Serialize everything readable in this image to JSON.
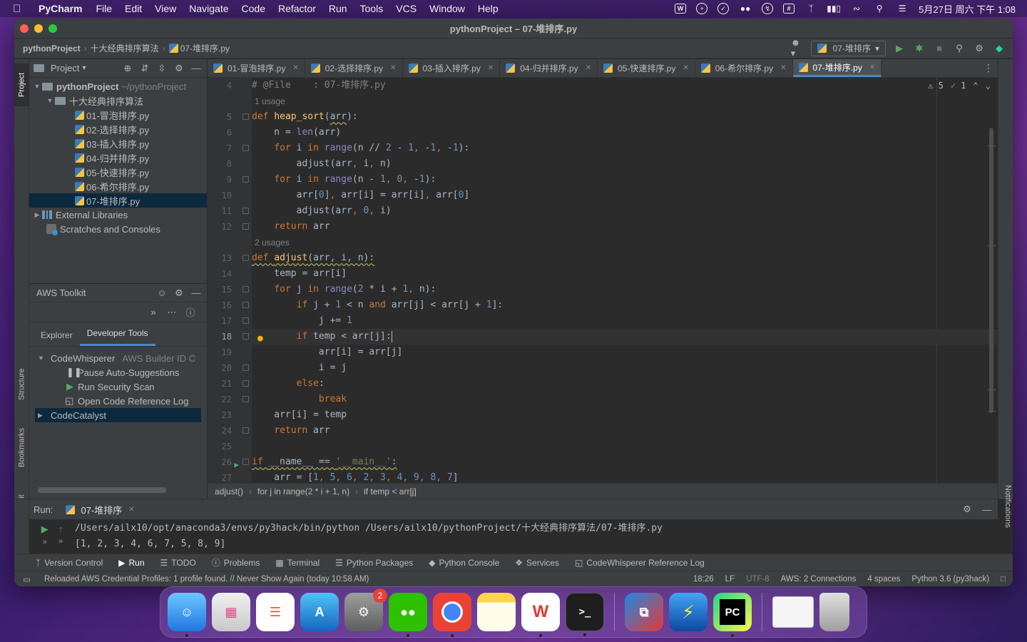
{
  "menubar": {
    "app_name": "PyCharm",
    "items": [
      "File",
      "Edit",
      "View",
      "Navigate",
      "Code",
      "Refactor",
      "Run",
      "Tools",
      "VCS",
      "Window",
      "Help"
    ],
    "clock": "5月27日 周六 下午 1:08"
  },
  "window": {
    "title": "pythonProject – 07-堆排序.py"
  },
  "navbar": {
    "crumbs": [
      "pythonProject",
      "十大经典排序算法",
      "07-堆排序.py"
    ],
    "run_config": "07-堆排序"
  },
  "project_panel": {
    "title": "Project",
    "root": "pythonProject",
    "root_hint": "~/pythonProject",
    "folder": "十大经典排序算法",
    "files": [
      "01-冒泡排序.py",
      "02-选择排序.py",
      "03-插入排序.py",
      "04-归并排序.py",
      "05-快速排序.py",
      "06-希尔排序.py",
      "07-堆排序.py"
    ],
    "selected_file": "07-堆排序.py",
    "external_libraries": "External Libraries",
    "scratches": "Scratches and Consoles"
  },
  "left_stripe": {
    "project": "Project",
    "structure": "Structure",
    "bookmarks": "Bookmarks",
    "aws_toolkit": "AWS Toolkit"
  },
  "aws_panel": {
    "title": "AWS Toolkit",
    "tabs": [
      "Explorer",
      "Developer Tools"
    ],
    "active_tab": "Developer Tools",
    "codewhisperer": "CodeWhisperer",
    "codewhisperer_hint": "AWS Builder ID C",
    "items": [
      "Pause Auto-Suggestions",
      "Run Security Scan",
      "Open Code Reference Log"
    ],
    "codecatalyst": "CodeCatalyst"
  },
  "editor": {
    "tabs": [
      "01-冒泡排序.py",
      "02-选择排序.py",
      "03-插入排序.py",
      "04-归并排序.py",
      "05-快速排序.py",
      "06-希尔排序.py",
      "07-堆排序.py"
    ],
    "active_tab": "07-堆排序.py",
    "warnings": "5",
    "weak_warnings": "1",
    "usage_hint_1": "1 usage",
    "usage_hint_2": "2 usages",
    "current_line": 18,
    "line_numbers": [
      "4",
      "5",
      "6",
      "7",
      "8",
      "9",
      "10",
      "11",
      "12",
      "13",
      "14",
      "15",
      "16",
      "17",
      "18",
      "19",
      "20",
      "21",
      "22",
      "23",
      "24",
      "25",
      "26",
      "27"
    ],
    "file_comment": "# @File    : 07-堆排序.py",
    "breadcrumbs": [
      "adjust()",
      "for j in range(2 * i + 1, n)",
      "if temp < arr[j]"
    ]
  },
  "run_panel": {
    "label": "Run:",
    "tab": "07-堆排序",
    "command": "/Users/ailx10/opt/anaconda3/envs/py3hack/bin/python /Users/ailx10/pythonProject/十大经典排序算法/07-堆排序.py",
    "output": "[1, 2, 3, 4, 6, 7, 5, 8, 9]"
  },
  "bottom_tools": [
    "Version Control",
    "Run",
    "TODO",
    "Problems",
    "Terminal",
    "Python Packages",
    "Python Console",
    "Services",
    "CodeWhisperer Reference Log"
  ],
  "active_bottom_tool": "Run",
  "right_stripe": {
    "notifications": "Notifications"
  },
  "statusbar": {
    "message": "Reloaded AWS Credential Profiles: 1 profile found. // Never Show Again (today 10:58 AM)",
    "position": "18:26",
    "line_ending": "LF",
    "encoding": "UTF-8",
    "aws": "AWS: 2 Connections",
    "indent": "4 spaces",
    "interpreter": "Python 3.6 (py3hack)"
  },
  "dock": {
    "settings_badge": "2"
  },
  "colors": {
    "accent": "#4a88c7",
    "keyword": "#cc7832",
    "function": "#ffc66d",
    "number": "#6897bb",
    "run_green": "#59a869"
  }
}
